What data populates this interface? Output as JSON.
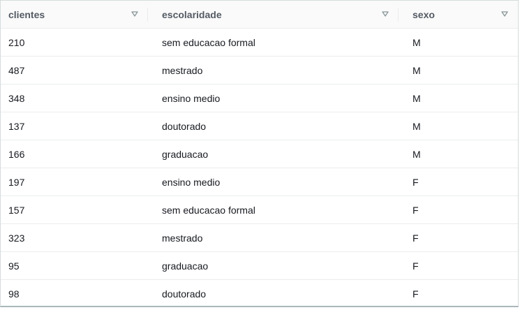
{
  "table": {
    "columns": [
      {
        "label": "clientes"
      },
      {
        "label": "escolaridade"
      },
      {
        "label": "sexo"
      }
    ],
    "sort_icon": "sort-triangle-down-icon",
    "rows": [
      {
        "clientes": "210",
        "escolaridade": "sem educacao formal",
        "sexo": "M"
      },
      {
        "clientes": "487",
        "escolaridade": "mestrado",
        "sexo": "M"
      },
      {
        "clientes": "348",
        "escolaridade": "ensino medio",
        "sexo": "M"
      },
      {
        "clientes": "137",
        "escolaridade": "doutorado",
        "sexo": "M"
      },
      {
        "clientes": "166",
        "escolaridade": "graduacao",
        "sexo": "M"
      },
      {
        "clientes": "197",
        "escolaridade": "ensino medio",
        "sexo": "F"
      },
      {
        "clientes": "157",
        "escolaridade": "sem educacao formal",
        "sexo": "F"
      },
      {
        "clientes": "323",
        "escolaridade": "mestrado",
        "sexo": "F"
      },
      {
        "clientes": "95",
        "escolaridade": "graduacao",
        "sexo": "F"
      },
      {
        "clientes": "98",
        "escolaridade": "doutorado",
        "sexo": "F"
      }
    ]
  }
}
